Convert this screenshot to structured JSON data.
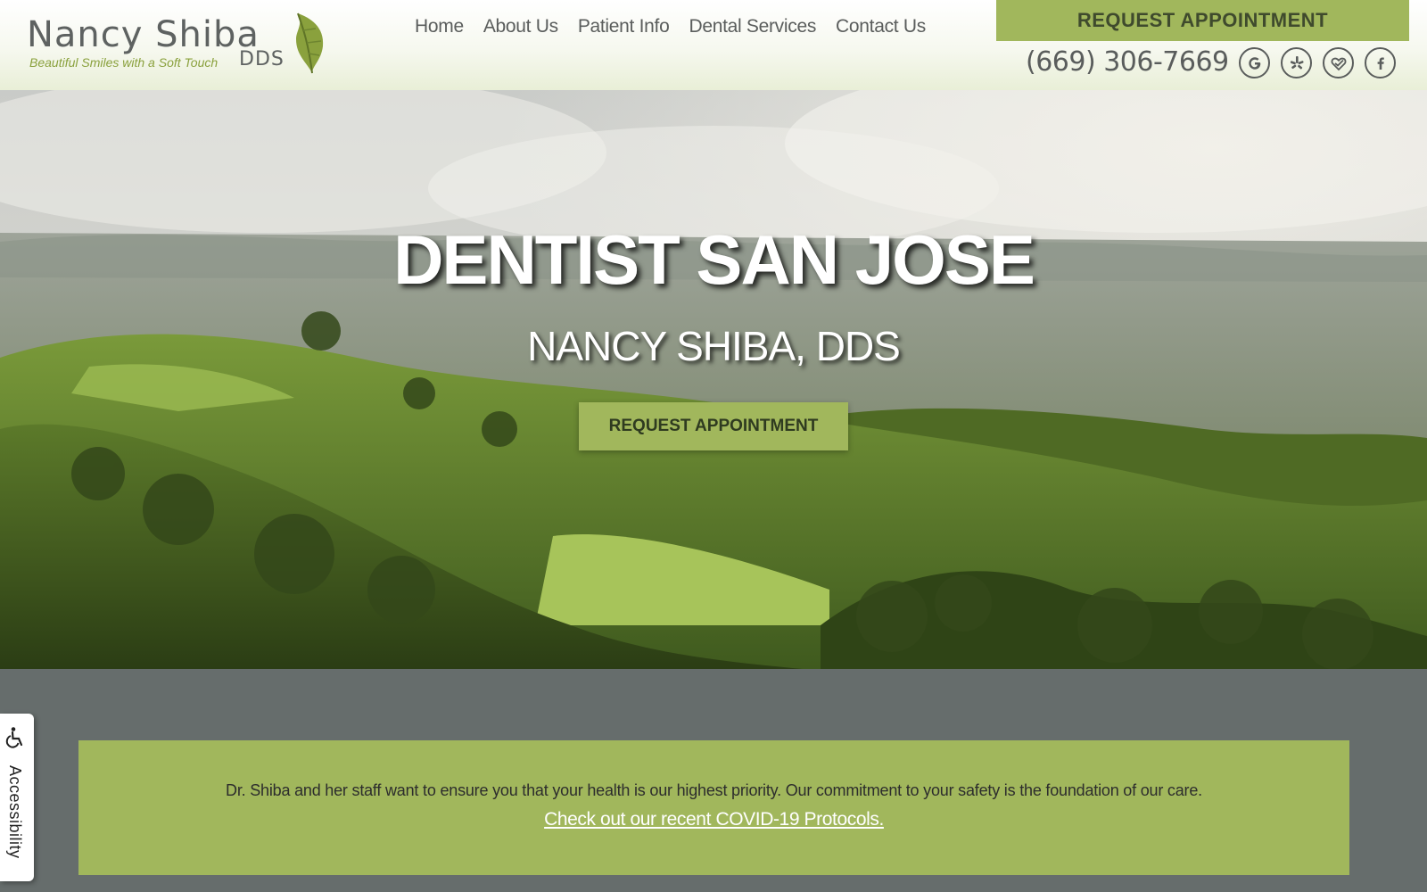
{
  "logo": {
    "name": "Nancy Shiba",
    "tagline": "Beautiful Smiles with a Soft Touch",
    "suffix": "DDS"
  },
  "nav": {
    "items": [
      "Home",
      "About Us",
      "Patient Info",
      "Dental Services",
      "Contact Us"
    ]
  },
  "header": {
    "cta_label": "REQUEST APPOINTMENT",
    "phone": "(669) 306-7669",
    "social_icons": [
      "google-icon",
      "yelp-icon",
      "healthgrades-icon",
      "facebook-icon"
    ]
  },
  "hero": {
    "title": "DENTIST SAN JOSE",
    "subtitle": "NANCY SHIBA, DDS",
    "cta_label": "REQUEST APPOINTMENT"
  },
  "notice": {
    "text": "Dr. Shiba and her staff want to ensure you that your health is our highest priority. Our commitment to your safety is the foundation of our care.",
    "link": "Check out our recent COVID-19 Protocols."
  },
  "accessibility": {
    "label": "Accessibility"
  },
  "colors": {
    "accent_green": "#a1b75c",
    "text_gray": "#5a5d5c",
    "page_bg": "#666d6c"
  }
}
